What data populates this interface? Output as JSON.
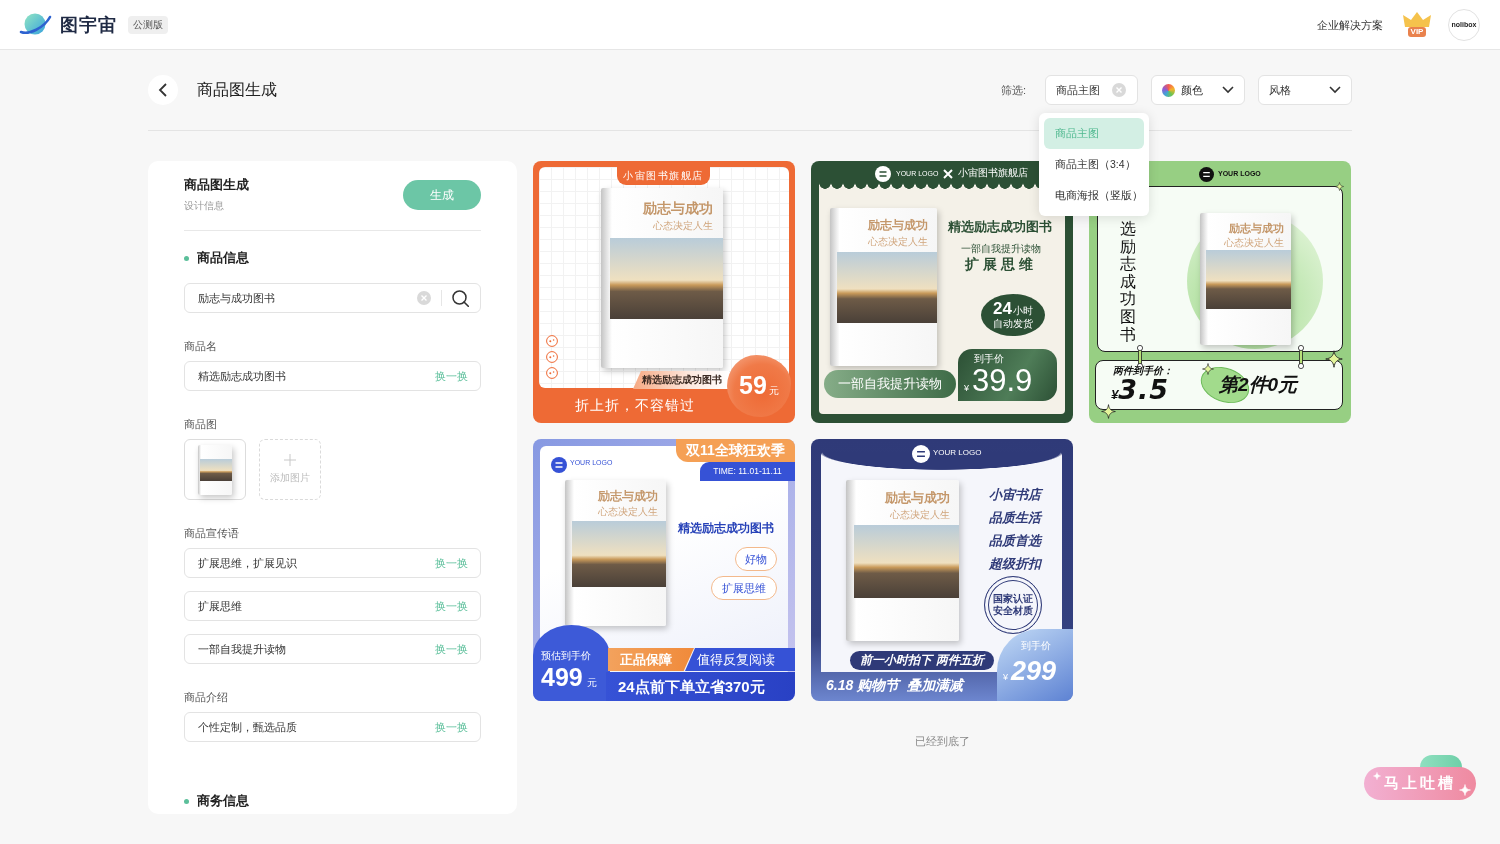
{
  "header": {
    "brand": "图宇宙",
    "badge": "公测版",
    "link": "企业解决方案",
    "vip_label": "VIP",
    "avatar_text": "nolibox"
  },
  "page": {
    "title": "商品图生成"
  },
  "filters": {
    "label": "筛选:",
    "dropdowns": [
      {
        "kind": "clearable",
        "value": "商品主图",
        "menu": {
          "options": [
            {
              "label": "商品主图",
              "selected": true
            },
            {
              "label": "商品主图（3:4）",
              "selected": false
            },
            {
              "label": "电商海报（竖版）",
              "selected": false
            }
          ]
        }
      },
      {
        "kind": "color",
        "value": "颜色"
      },
      {
        "kind": "plain",
        "value": "风格"
      }
    ]
  },
  "form": {
    "title": "商品图生成",
    "subtitle": "设计信息",
    "generate_button": "生成",
    "sections": [
      {
        "heading": "商品信息",
        "search": {
          "value": "励志与成功图书"
        },
        "groups": [
          {
            "kind": "text",
            "label": "商品名",
            "fields": [
              {
                "value": "精选励志成功图书",
                "action": "换一换"
              }
            ]
          },
          {
            "kind": "images",
            "label": "商品图",
            "add_label": "添加图片"
          },
          {
            "kind": "text",
            "label": "商品宣传语",
            "fields": [
              {
                "value": "扩展思维，扩展见识",
                "action": "换一换"
              },
              {
                "value": "扩展思维",
                "action": "换一换"
              },
              {
                "value": "一部自我提升读物",
                "action": "换一换"
              }
            ]
          },
          {
            "kind": "text",
            "label": "商品介绍",
            "fields": [
              {
                "value": "个性定制，甄选品质",
                "action": "换一换"
              }
            ]
          }
        ]
      },
      {
        "heading": "商务信息"
      }
    ]
  },
  "results": {
    "cards": [
      {
        "kind": "orange_frame",
        "store_tab": "小宙图书旗舰店",
        "book": {
          "title": "励志与成功",
          "subtitle": "心态决定人生"
        },
        "product_label": "精选励志成功图书",
        "price": "59",
        "price_unit": "元",
        "footer": "折上折，不容错过"
      },
      {
        "kind": "green_scallop",
        "logo_text": "YOUR LOGO",
        "store": "小宙图书旗舰店",
        "book": {
          "title": "励志与成功",
          "subtitle": "心态决定人生"
        },
        "headline": "精选励志成功图书",
        "tagline": "一部自我提升读物",
        "highlight": "扩展思维",
        "bubble_number": "24",
        "bubble_unit": "小时",
        "bubble_caption": "自动发货",
        "price_label": "到手价",
        "currency": "¥",
        "price": "39.9",
        "slogan": "一部自我提升读物"
      },
      {
        "kind": "mint_hooks",
        "logo_text": "YOUR LOGO",
        "vertical_title": "选励志成功图书",
        "book": {
          "title": "励志与成功",
          "subtitle": "心态决定人生"
        },
        "price_label": "两件到手价：",
        "currency": "¥",
        "price": "3.5",
        "offer": "第2件0元"
      },
      {
        "kind": "blue_double11",
        "logo_text": "YOUR LOGO",
        "event": "双11全球狂欢季",
        "time": "TIME: 11.01-11.11",
        "book": {
          "title": "励志与成功",
          "subtitle": "心态决定人生"
        },
        "headline": "精选励志成功图书",
        "tags": [
          "好物",
          "扩展思维"
        ],
        "price_label": "预估到手价",
        "price": "499",
        "price_unit": "元",
        "badge": "正品保障",
        "slogan": "值得反复阅读",
        "footer": "24点前下单立省370元"
      },
      {
        "kind": "navy_618",
        "logo_text": "YOUR LOGO",
        "book": {
          "title": "励志与成功",
          "subtitle": "心态决定人生"
        },
        "lines": [
          "小宙书店",
          "品质生活",
          "品质首选",
          "超级折扣"
        ],
        "seal": [
          "国家认证",
          "安全材质"
        ],
        "deal": "前一小时拍下 两件五折",
        "footer": "6.18 购物节  叠加满减",
        "price_label": "到手价",
        "currency": "¥",
        "price": "299"
      }
    ],
    "end_note": "已经到底了"
  },
  "feedback_button": {
    "label": "马上吐槽"
  }
}
